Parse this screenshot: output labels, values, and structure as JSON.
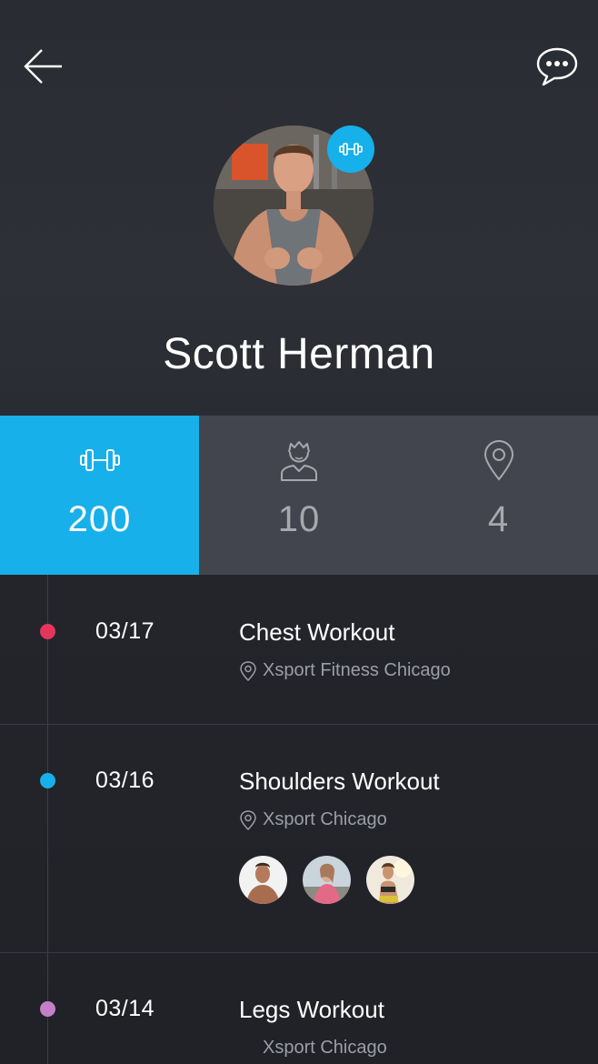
{
  "profile": {
    "name": "Scott Herman"
  },
  "stats": [
    {
      "icon": "dumbbell-icon",
      "value": "200",
      "active": true
    },
    {
      "icon": "person-icon",
      "value": "10",
      "active": false
    },
    {
      "icon": "location-pin-icon",
      "value": "4",
      "active": false
    }
  ],
  "timeline": [
    {
      "date": "03/17",
      "title": "Chest Workout",
      "location": "Xsport Fitness Chicago",
      "dot_color": "#e4365c"
    },
    {
      "date": "03/16",
      "title": "Shoulders Workout",
      "location": "Xsport Chicago",
      "dot_color": "#17b0ea",
      "participants": [
        "participant-1",
        "participant-2",
        "participant-3"
      ]
    },
    {
      "date": "03/14",
      "title": "Legs Workout",
      "location": "Xsport Chicago",
      "dot_color": "#c57ec8"
    }
  ],
  "colors": {
    "accent": "#17b0ea",
    "background": "#2a2c33",
    "stats_bar": "#43454e"
  }
}
